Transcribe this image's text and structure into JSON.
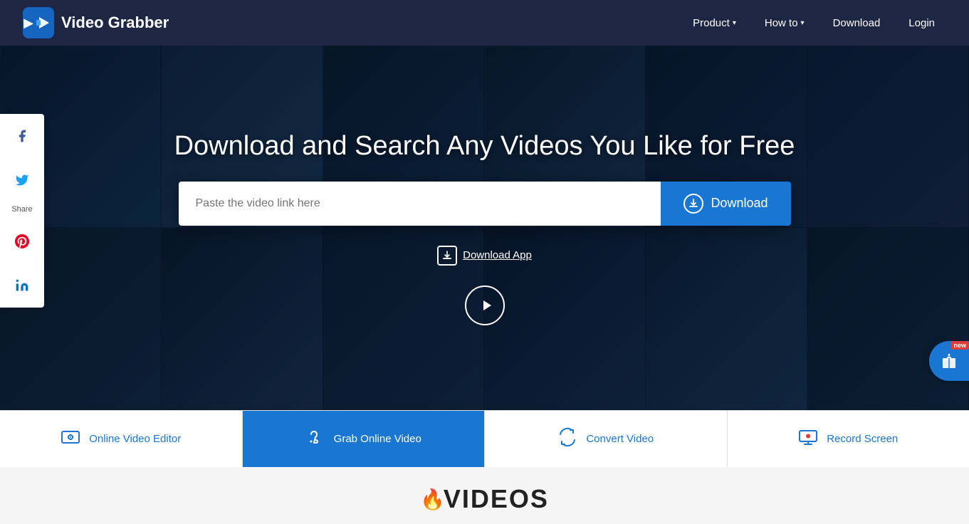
{
  "navbar": {
    "logo_text_light": "Video ",
    "logo_text_bold": "Grabber",
    "nav_items": [
      {
        "id": "product",
        "label": "Product",
        "has_dropdown": true
      },
      {
        "id": "howto",
        "label": "How to",
        "has_dropdown": true
      },
      {
        "id": "download",
        "label": "Download",
        "has_dropdown": false
      },
      {
        "id": "login",
        "label": "Login",
        "has_dropdown": false
      }
    ]
  },
  "hero": {
    "title": "Download and Search Any Videos You Like for Free",
    "search_placeholder": "Paste the video link here",
    "download_button_label": "Download",
    "download_app_label": "Download App"
  },
  "social": {
    "share_label": "Share",
    "items": [
      {
        "id": "facebook",
        "icon": "f",
        "label": "Facebook"
      },
      {
        "id": "twitter",
        "icon": "𝕏",
        "label": "Twitter"
      },
      {
        "id": "pinterest",
        "icon": "P",
        "label": "Pinterest"
      },
      {
        "id": "linkedin",
        "icon": "in",
        "label": "LinkedIn"
      }
    ]
  },
  "bottom_tabs": [
    {
      "id": "online-video-editor",
      "label": "Online Video Editor",
      "active": false
    },
    {
      "id": "grab-online-video",
      "label": "Grab Online Video",
      "active": true
    },
    {
      "id": "convert-video",
      "label": "Convert Video",
      "active": false
    },
    {
      "id": "record-screen",
      "label": "Record Screen",
      "active": false
    }
  ],
  "gift_badge": "new",
  "videos_logo": "VIDEOS"
}
